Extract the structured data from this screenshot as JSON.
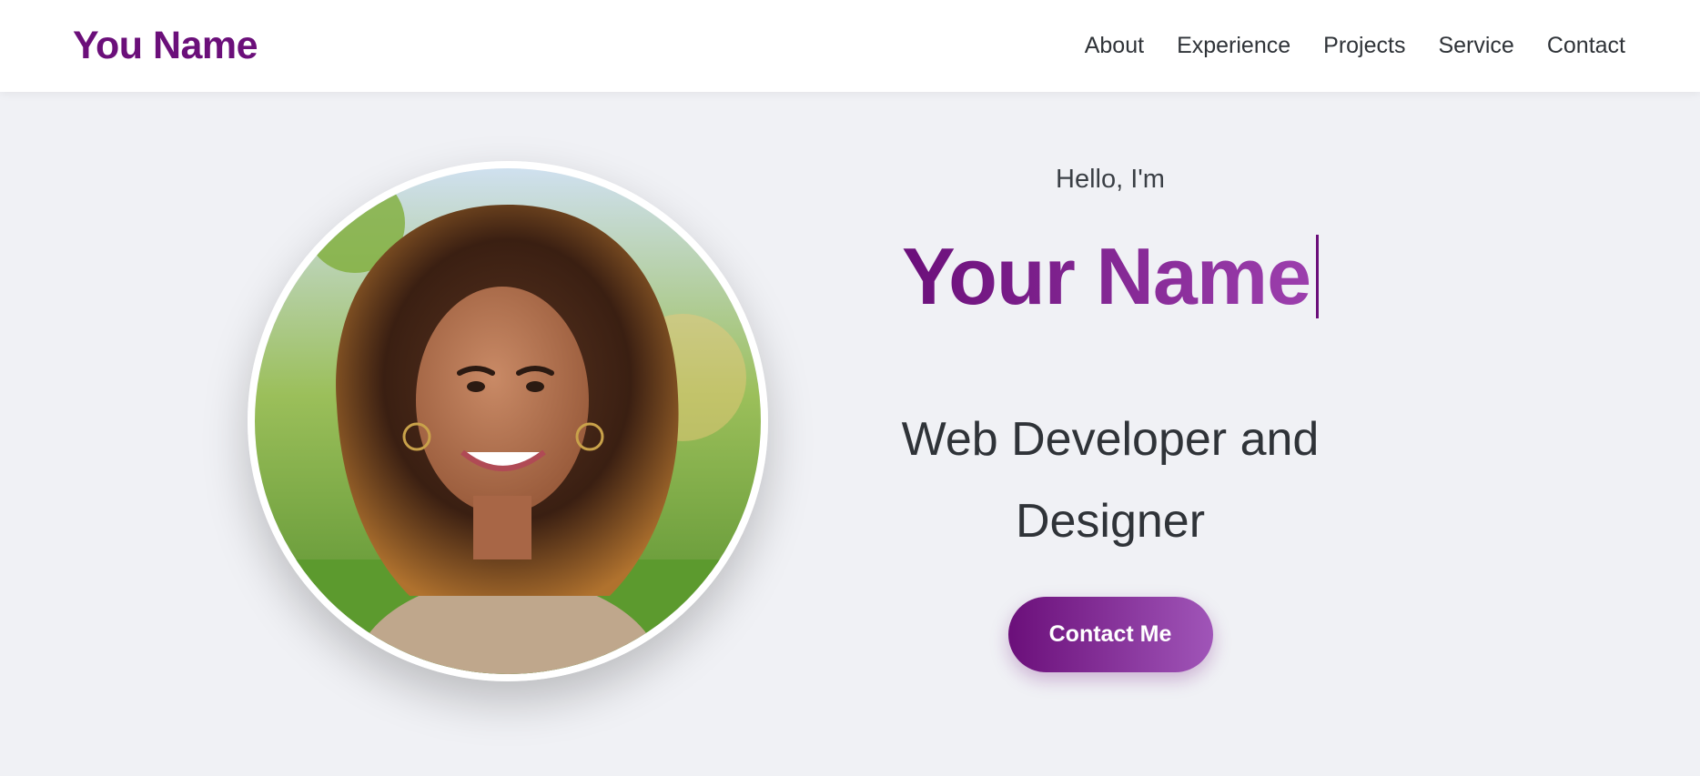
{
  "header": {
    "logo": "You Name",
    "nav": [
      {
        "label": "About"
      },
      {
        "label": "Experience"
      },
      {
        "label": "Projects"
      },
      {
        "label": "Service"
      },
      {
        "label": "Contact"
      }
    ]
  },
  "hero": {
    "greeting": "Hello, I'm",
    "name": "Your Name",
    "role_line1": "Web Developer and",
    "role_line2": "Designer",
    "cta": "Contact Me",
    "photo_icon": "portrait-photo"
  },
  "colors": {
    "brand": "#6b0f7a",
    "accent_light": "#a055b8",
    "background": "#f0f1f5",
    "text": "#2f3338"
  }
}
